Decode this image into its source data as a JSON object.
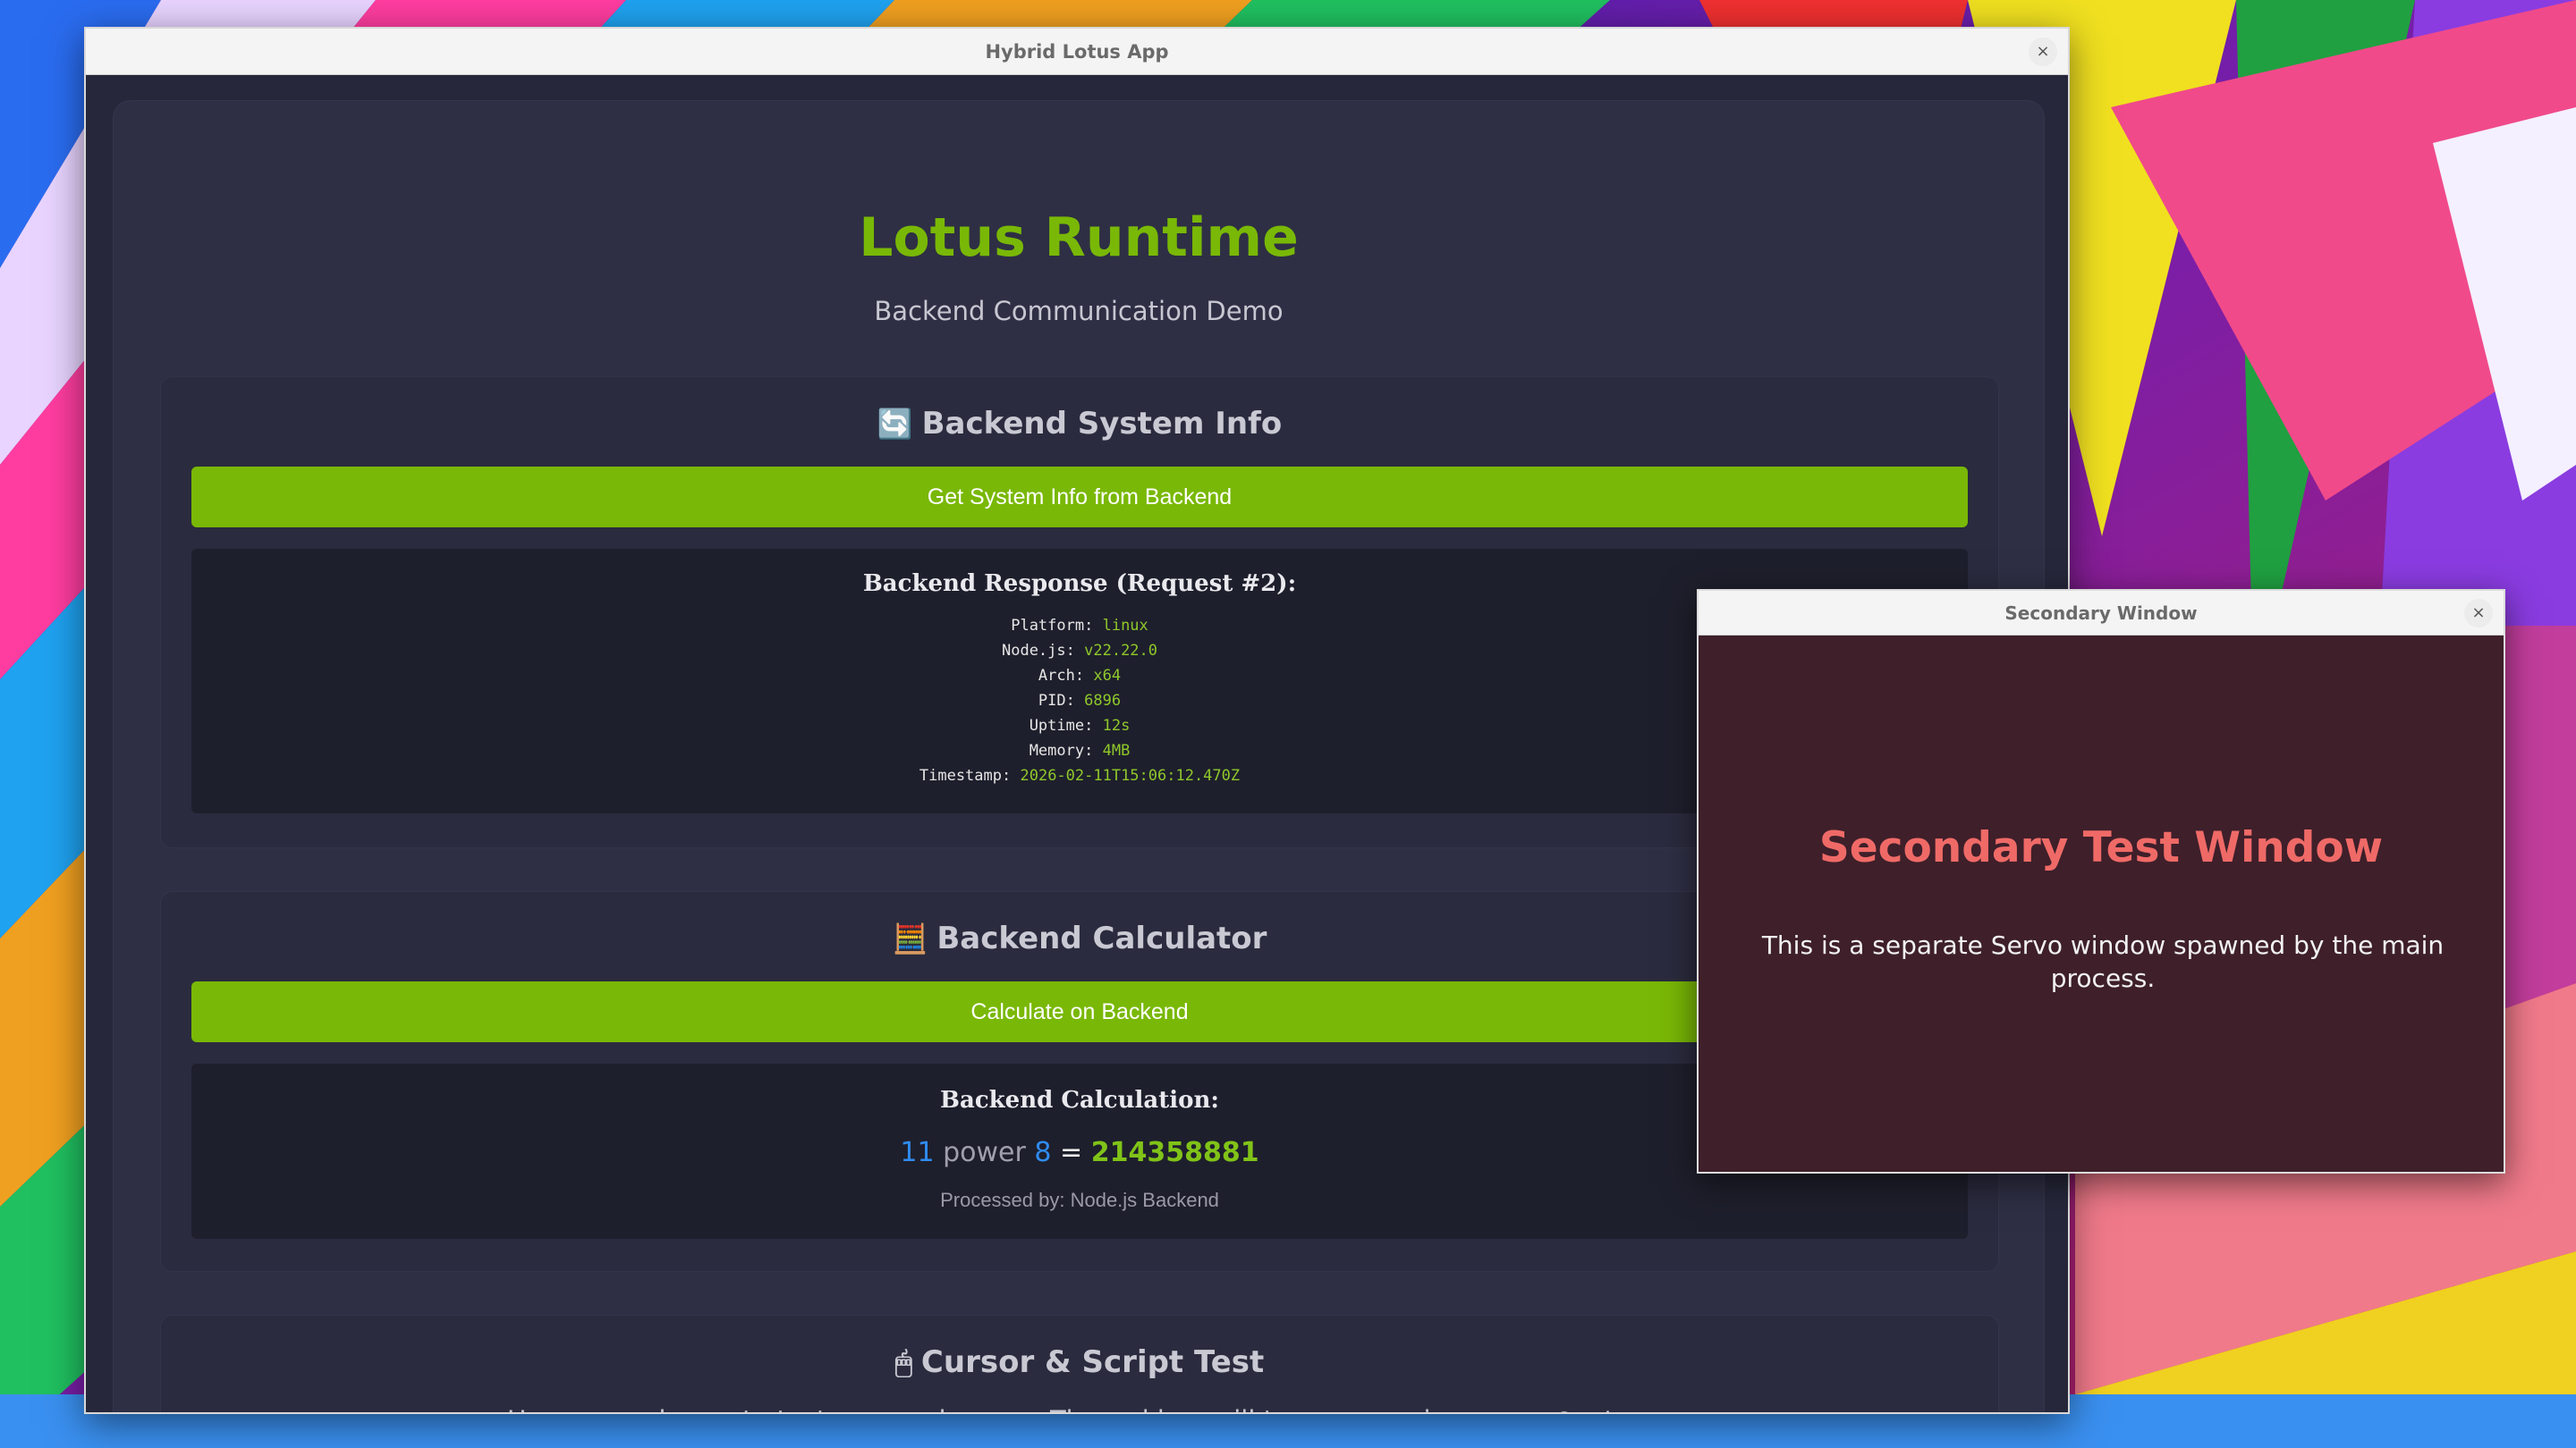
{
  "main_window": {
    "title": "Hybrid Lotus App",
    "close_glyph": "×"
  },
  "header": {
    "title": "Lotus Runtime",
    "subtitle": "Backend Communication Demo"
  },
  "system_info": {
    "emoji": "🔄",
    "heading": "Backend System Info",
    "button_label": "Get System Info from Backend",
    "response_heading": "Backend Response (Request #2):",
    "rows": [
      {
        "key": "Platform:",
        "value": "linux"
      },
      {
        "key": "Node.js:",
        "value": "v22.22.0"
      },
      {
        "key": "Arch:",
        "value": "x64"
      },
      {
        "key": "PID:",
        "value": "6896"
      },
      {
        "key": "Uptime:",
        "value": "12s"
      },
      {
        "key": "Memory:",
        "value": "4MB"
      },
      {
        "key": "Timestamp:",
        "value": "2026-02-11T15:06:12.470Z"
      }
    ]
  },
  "calculator": {
    "emoji": "🧮",
    "heading": "Backend Calculator",
    "button_label": "Calculate on Backend",
    "result_heading": "Backend Calculation:",
    "operand_a": "11",
    "operator": "power",
    "operand_b": "8",
    "equals": "=",
    "result": "214358881",
    "processed_by": "Processed by: Node.js Backend"
  },
  "cursor_test": {
    "emoji": "🖱",
    "heading": "Cursor & Script Test",
    "description_before": "Hover over boxes to test cursor changes. The red box will turn green via ",
    "code": "executeScript",
    "description_after": "."
  },
  "secondary_window": {
    "title": "Secondary Window",
    "close_glyph": "×",
    "heading": "Secondary Test Window",
    "text": "This is a separate Servo window spawned by the main process."
  },
  "colors": {
    "accent_green": "#79b806",
    "secondary_heading": "#ef6a67",
    "operand_blue": "#2f8cf0"
  }
}
